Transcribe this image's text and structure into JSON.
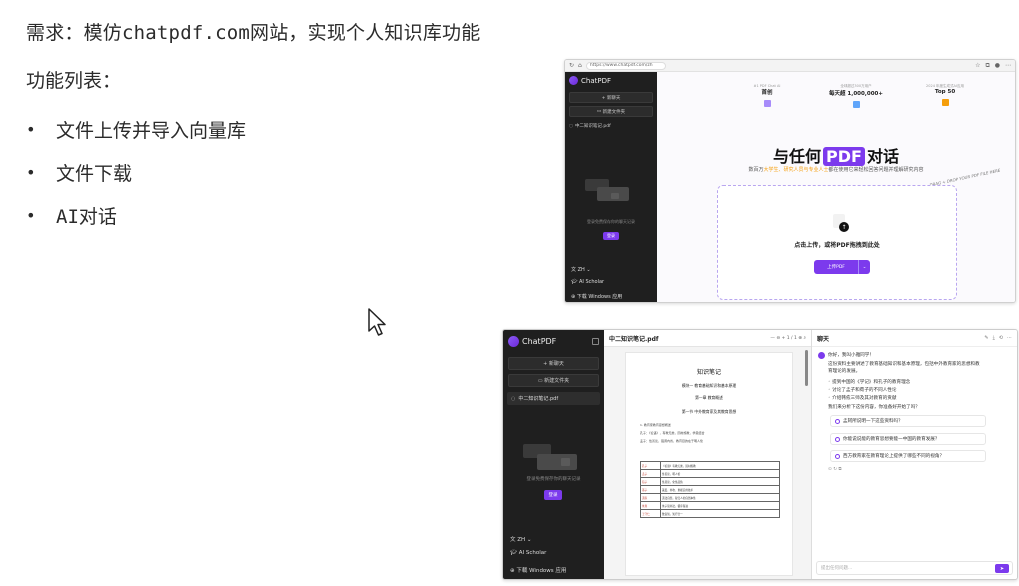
{
  "slide": {
    "title": "需求：模仿chatpdf.com网站，实现个人知识库功能",
    "subtitle": "功能列表：",
    "bullets": [
      "文件上传并导入向量库",
      "文件下载",
      "AI对话"
    ],
    "bullet_symbol": "•"
  },
  "cursor": {
    "icon": "pointer-arrow-icon"
  },
  "shot1": {
    "url": "https://www.chatpdf.com/zh",
    "logo_text": "ChatPDF",
    "new_chat": "+ 新聊天",
    "new_folder": "新建文件夹",
    "file_name": "中二知识笔记.pdf",
    "login_hint": "登录免费保存你的聊天记录",
    "login_button": "登录",
    "lang": "ZH",
    "scholar": "AI Scholar",
    "download_app": "下载 Windows 应用",
    "laurels": [
      {
        "top": "#1 PDF Chat AI",
        "main": "首创"
      },
      {
        "top": "全球超过300万用户",
        "main": "每天超 1,000,000+"
      },
      {
        "top": "2024 年度生成式AI应用",
        "main": "Top 50"
      }
    ],
    "headline_pre": "与任何",
    "headline_chip": "PDF",
    "headline_post": "对话",
    "sub_pre": "数百万",
    "sub_hl": "大学生、研究人员与专业人士",
    "sub_post": "都在使用它来轻松回答问题并理解研究内容",
    "drag_note": "DRAG + DROP YOUR PDF FILE HERE",
    "drop_text": "点击上传，或将PDF拖拽到此处",
    "upload_button": "上传PDF",
    "colors": {
      "accent": "#7c3aed",
      "sidebar": "#1f1f1f"
    }
  },
  "shot2": {
    "logo_text": "ChatPDF",
    "new_chat": "+ 新聊天",
    "new_folder": "新建文件夹",
    "file_name": "中二知识笔记.pdf",
    "login_hint": "登录免费保存你的聊天记录",
    "login_button": "登录",
    "lang": "ZH",
    "scholar": "AI Scholar",
    "download_app": "下载 Windows 应用",
    "pdf": {
      "toolbar_name": "中二知识笔记.pdf",
      "controls": "—  ⊖  +  1 / 1  ⊕  ⌕",
      "page_title": "知识笔记",
      "module": "模块一 教育基础知识和基本原理",
      "chapter": "第一章 教育概述",
      "section": "第一节 中外教育家及其教育思想",
      "para1": "1. 教育家教育思想概述",
      "para2": "孔子：《论语》，有教无类，因材施教，学思结合",
      "para3": "孟子：性善论，强调内省，教育目的在于明人伦",
      "table": [
        [
          "孔子",
          "《论语》有教无类，因材施教"
        ],
        [
          "孟子",
          "性善论，明人伦"
        ],
        [
          "荀子",
          "性恶论，化性起伪"
        ],
        [
          "墨子",
          "兼爱、非攻、重视实用技术"
        ],
        [
          "道家",
          "道法自然，复归人的自然本性"
        ],
        [
          "朱熹",
          "朱子读书法，循序渐进"
        ],
        [
          "王守仁",
          "致良知，知行合一"
        ]
      ]
    },
    "chat": {
      "title": "聊天",
      "header_icons": [
        "✎",
        "⤓",
        "⟲",
        "⋯"
      ],
      "greeting": "你好，我叫小雅同学！",
      "intro_1": "这份资料主要讲述了教育基础知识和基本原理，包括中外教育家的思想和教",
      "intro_2": "育理论的发展。",
      "points": [
        "◦ 提到中国的《学记》和孔子的教育理念",
        "◦ 讨论了孟子和荀子的不同人性论",
        "◦ 介绍韩愈三师及其对教育的贡献"
      ],
      "prompt": "我们来分析下这份内容，你准备好开始了吗？",
      "suggestions": [
        "孟轲所说明一下这些资料吗？",
        "你能说说能的教育思想要能一中国的教育发展？",
        "西方教育家在教育理论上提供了哪些不同的视角？"
      ],
      "actions": "⊙  ↻  ⧉",
      "input_placeholder": "提出任何问题...",
      "send": "➤"
    }
  }
}
